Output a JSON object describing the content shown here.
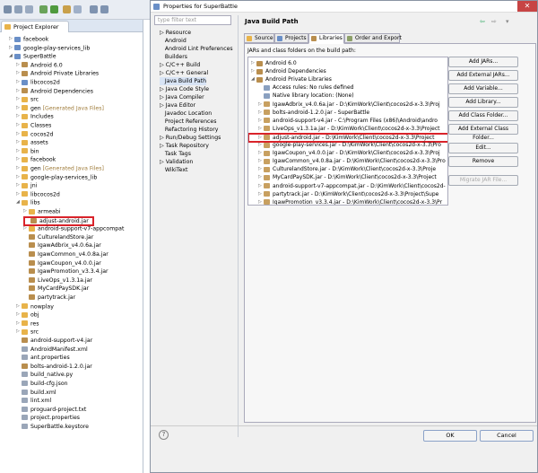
{
  "project_explorer": {
    "title": "Project Explorer",
    "items": [
      {
        "label": "facebook",
        "gen": ""
      },
      {
        "label": "google-play-services_lib",
        "gen": ""
      },
      {
        "label": "SuperBattle",
        "gen": ""
      },
      {
        "label": "Android 6.0",
        "gen": ""
      },
      {
        "label": "Android Private Libraries",
        "gen": ""
      },
      {
        "label": "libcocos2d",
        "gen": ""
      },
      {
        "label": "Android Dependencies",
        "gen": ""
      },
      {
        "label": "src",
        "gen": ""
      },
      {
        "label": "gen",
        "gen": "[Generated Java Files]"
      },
      {
        "label": "Includes",
        "gen": ""
      },
      {
        "label": "Classes",
        "gen": ""
      },
      {
        "label": "cocos2d",
        "gen": ""
      },
      {
        "label": "assets",
        "gen": ""
      },
      {
        "label": "bin",
        "gen": ""
      },
      {
        "label": "facebook",
        "gen": ""
      },
      {
        "label": "gen",
        "gen": "[Generated Java Files]"
      },
      {
        "label": "google-play-services_lib",
        "gen": ""
      },
      {
        "label": "jni",
        "gen": ""
      },
      {
        "label": "libcocos2d",
        "gen": ""
      },
      {
        "label": "libs",
        "gen": ""
      },
      {
        "label": "armeabi",
        "gen": ""
      },
      {
        "label": "adjust-android.jar",
        "gen": ""
      },
      {
        "label": "android-support-v7-appcompat",
        "gen": ""
      },
      {
        "label": "CulturelandStore.jar",
        "gen": ""
      },
      {
        "label": "IgawAdbrix_v4.0.6a.jar",
        "gen": ""
      },
      {
        "label": "IgawCommon_v4.0.8a.jar",
        "gen": ""
      },
      {
        "label": "IgawCoupon_v4.0.0.jar",
        "gen": ""
      },
      {
        "label": "IgawPromotion_v3.3.4.jar",
        "gen": ""
      },
      {
        "label": "LiveOps_v1.3.1a.jar",
        "gen": ""
      },
      {
        "label": "MyCardPaySDK.jar",
        "gen": ""
      },
      {
        "label": "partytrack.jar",
        "gen": ""
      },
      {
        "label": "nowplay",
        "gen": ""
      },
      {
        "label": "obj",
        "gen": ""
      },
      {
        "label": "res",
        "gen": ""
      },
      {
        "label": "src",
        "gen": ""
      },
      {
        "label": "android-support-v4.jar",
        "gen": ""
      },
      {
        "label": "AndroidManifest.xml",
        "gen": ""
      },
      {
        "label": "ant.properties",
        "gen": ""
      },
      {
        "label": "bolts-android-1.2.0.jar",
        "gen": ""
      },
      {
        "label": "build_native.py",
        "gen": ""
      },
      {
        "label": "build-cfg.json",
        "gen": ""
      },
      {
        "label": "build.xml",
        "gen": ""
      },
      {
        "label": "lint.xml",
        "gen": ""
      },
      {
        "label": "proguard-project.txt",
        "gen": ""
      },
      {
        "label": "project.properties",
        "gen": ""
      },
      {
        "label": "SuperBattle.keystore",
        "gen": ""
      }
    ]
  },
  "dialog": {
    "title": "Properties for SuperBattle",
    "filter_placeholder": "type filter text",
    "categories": [
      "Resource",
      "Android",
      "Android Lint Preferences",
      "Builders",
      "C/C++ Build",
      "C/C++ General",
      "Java Build Path",
      "Java Code Style",
      "Java Compiler",
      "Java Editor",
      "Javadoc Location",
      "Project References",
      "Refactoring History",
      "Run/Debug Settings",
      "Task Repository",
      "Task Tags",
      "Validation",
      "WikiText"
    ],
    "page_title": "Java Build Path",
    "tabs": [
      "Source",
      "Projects",
      "Libraries",
      "Order and Export"
    ],
    "list_caption": "JARs and class folders on the build path:",
    "list": [
      "Android 6.0",
      "Android Dependencies",
      "Android Private Libraries",
      "Access rules: No rules defined",
      "Native library location: (None)",
      "IgawAdbrix_v4.0.6a.jar - D:\\KimWork\\Client\\cocos2d-x-3.3\\Proj",
      "bolts-android-1.2.0.jar - SuperBattle",
      "android-support-v4.jar - C:\\Program Files (x86)\\Android\\andro",
      "LiveOps_v1.3.1a.jar - D:\\KimWork\\Client\\cocos2d-x-3.3\\Project",
      "adjust-android.jar - D:\\KimWork\\Client\\cocos2d-x-3.3\\Project",
      "google-play-services.jar - D:\\KimWork\\Client\\cocos2d-x-3.3\\Pro",
      "IgawCoupon_v4.0.0.jar - D:\\KimWork\\Client\\cocos2d-x-3.3\\Proj",
      "IgawCommon_v4.0.8a.jar - D:\\KimWork\\Client\\cocos2d-x-3.3\\Pro",
      "CulturelandStore.jar - D:\\KimWork\\Client\\cocos2d-x-3.3\\Proje",
      "MyCardPaySDK.jar - D:\\KimWork\\Client\\cocos2d-x-3.3\\Project",
      "android-support-v7-appcompat.jar - D:\\KimWork\\Client\\cocos2d-",
      "partytrack.jar - D:\\KimWork\\Client\\cocos2d-x-3.3\\Project\\Supe",
      "IgawPromotion_v3.3.4.jar - D:\\KimWork\\Client\\cocos2d-x-3.3\\Pr"
    ],
    "buttons": [
      "Add JARs...",
      "Add External JARs...",
      "Add Variable...",
      "Add Library...",
      "Add Class Folder...",
      "Add External Class Folder...",
      "Edit...",
      "Remove",
      "Migrate JAR File..."
    ],
    "ok": "OK",
    "cancel": "Cancel",
    "help": "?"
  },
  "colors": {
    "highlight": "#d9232a",
    "folder": "#e8b34a",
    "jar": "#b98e4e",
    "project": "#6a8fc7"
  }
}
